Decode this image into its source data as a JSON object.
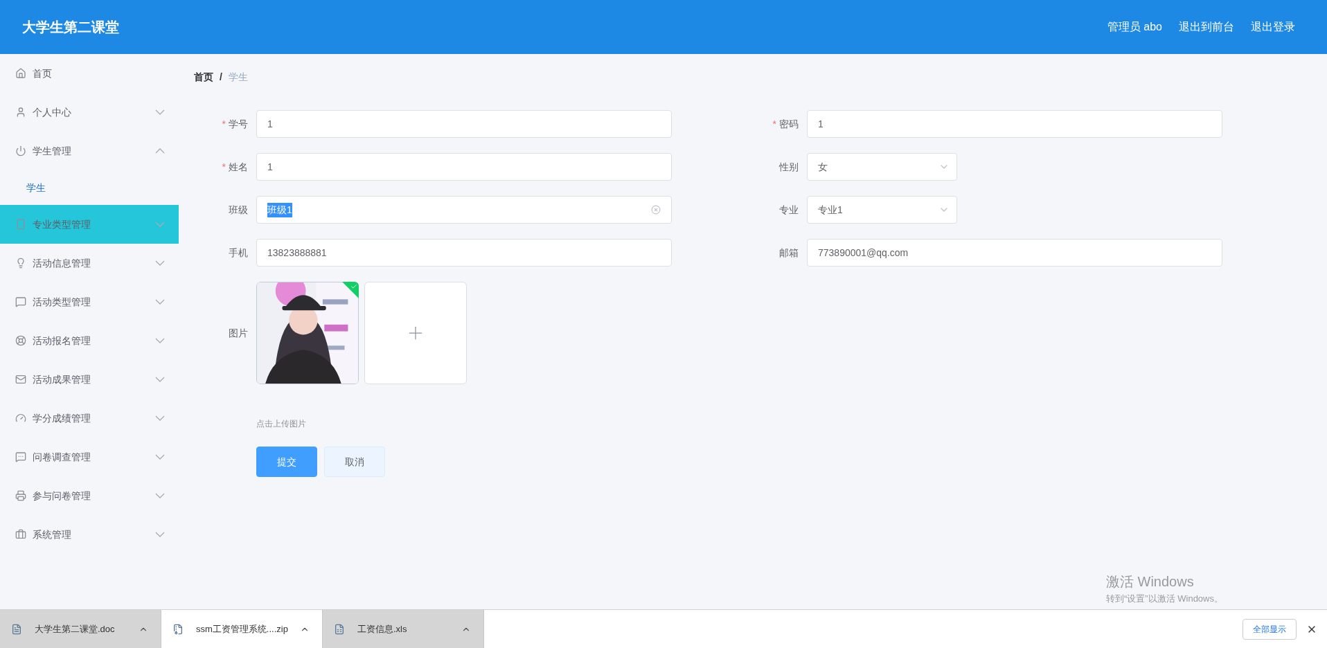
{
  "header": {
    "title": "大学生第二课堂",
    "links": [
      "管理员 abo",
      "退出到前台",
      "退出登录"
    ]
  },
  "sidebar": {
    "items": [
      {
        "label": "首页",
        "hovered": false
      },
      {
        "label": "个人中心",
        "expanded": false,
        "hovered": false
      },
      {
        "label": "学生管理",
        "expanded": true,
        "hovered": false,
        "children": [
          {
            "label": "学生",
            "selected": true
          }
        ]
      },
      {
        "label": "专业类型管理",
        "expanded": false,
        "hovered": true
      },
      {
        "label": "活动信息管理",
        "expanded": false,
        "hovered": false
      },
      {
        "label": "活动类型管理",
        "expanded": false,
        "hovered": false
      },
      {
        "label": "活动报名管理",
        "expanded": false,
        "hovered": false
      },
      {
        "label": "活动成果管理",
        "expanded": false,
        "hovered": false
      },
      {
        "label": "学分成绩管理",
        "expanded": false,
        "hovered": false
      },
      {
        "label": "问卷调查管理",
        "expanded": false,
        "hovered": false
      },
      {
        "label": "参与问卷管理",
        "expanded": false,
        "hovered": false
      },
      {
        "label": "系统管理",
        "expanded": false,
        "hovered": false
      }
    ]
  },
  "breadcrumb": {
    "separator": "/",
    "items": [
      {
        "label": "首页",
        "current": false
      },
      {
        "label": "学生",
        "current": true
      }
    ]
  },
  "form": {
    "rows": [
      [
        {
          "kind": "text",
          "label": "学号",
          "required_mark": "*",
          "value": "1"
        },
        {
          "kind": "text",
          "label": "密码",
          "required_mark": "*",
          "value": "1"
        }
      ],
      [
        {
          "kind": "text",
          "label": "姓名",
          "required_mark": "*",
          "value": "1"
        },
        {
          "kind": "select",
          "label": "性别",
          "value": "女"
        }
      ],
      [
        {
          "kind": "text",
          "label": "班级",
          "value": "班级1",
          "highlighted": true,
          "clearable": true
        },
        {
          "kind": "select",
          "label": "专业",
          "value": "专业1"
        }
      ],
      [
        {
          "kind": "text",
          "label": "手机",
          "value": "13823888881"
        },
        {
          "kind": "text",
          "label": "邮箱",
          "value": "773890001@qq.com"
        }
      ]
    ],
    "upload": {
      "label": "图片",
      "images": [
        {
          "kind": "picture",
          "success": true
        }
      ],
      "hint": "点击上传图片"
    },
    "buttons": [
      {
        "label": "提交",
        "primary": true
      },
      {
        "label": "取消",
        "primary": false
      }
    ]
  },
  "watermark_notice": {
    "title": "激活 Windows",
    "subtitle": "转到“设置”以激活 Windows。"
  },
  "downloads": {
    "items": [
      {
        "name": "大学生第二课堂.doc",
        "active": true
      },
      {
        "name": "ssm工资管理系统....zip",
        "active": false
      },
      {
        "name": "工资信息.xls",
        "active": true
      }
    ],
    "show_all": "全部显示"
  }
}
